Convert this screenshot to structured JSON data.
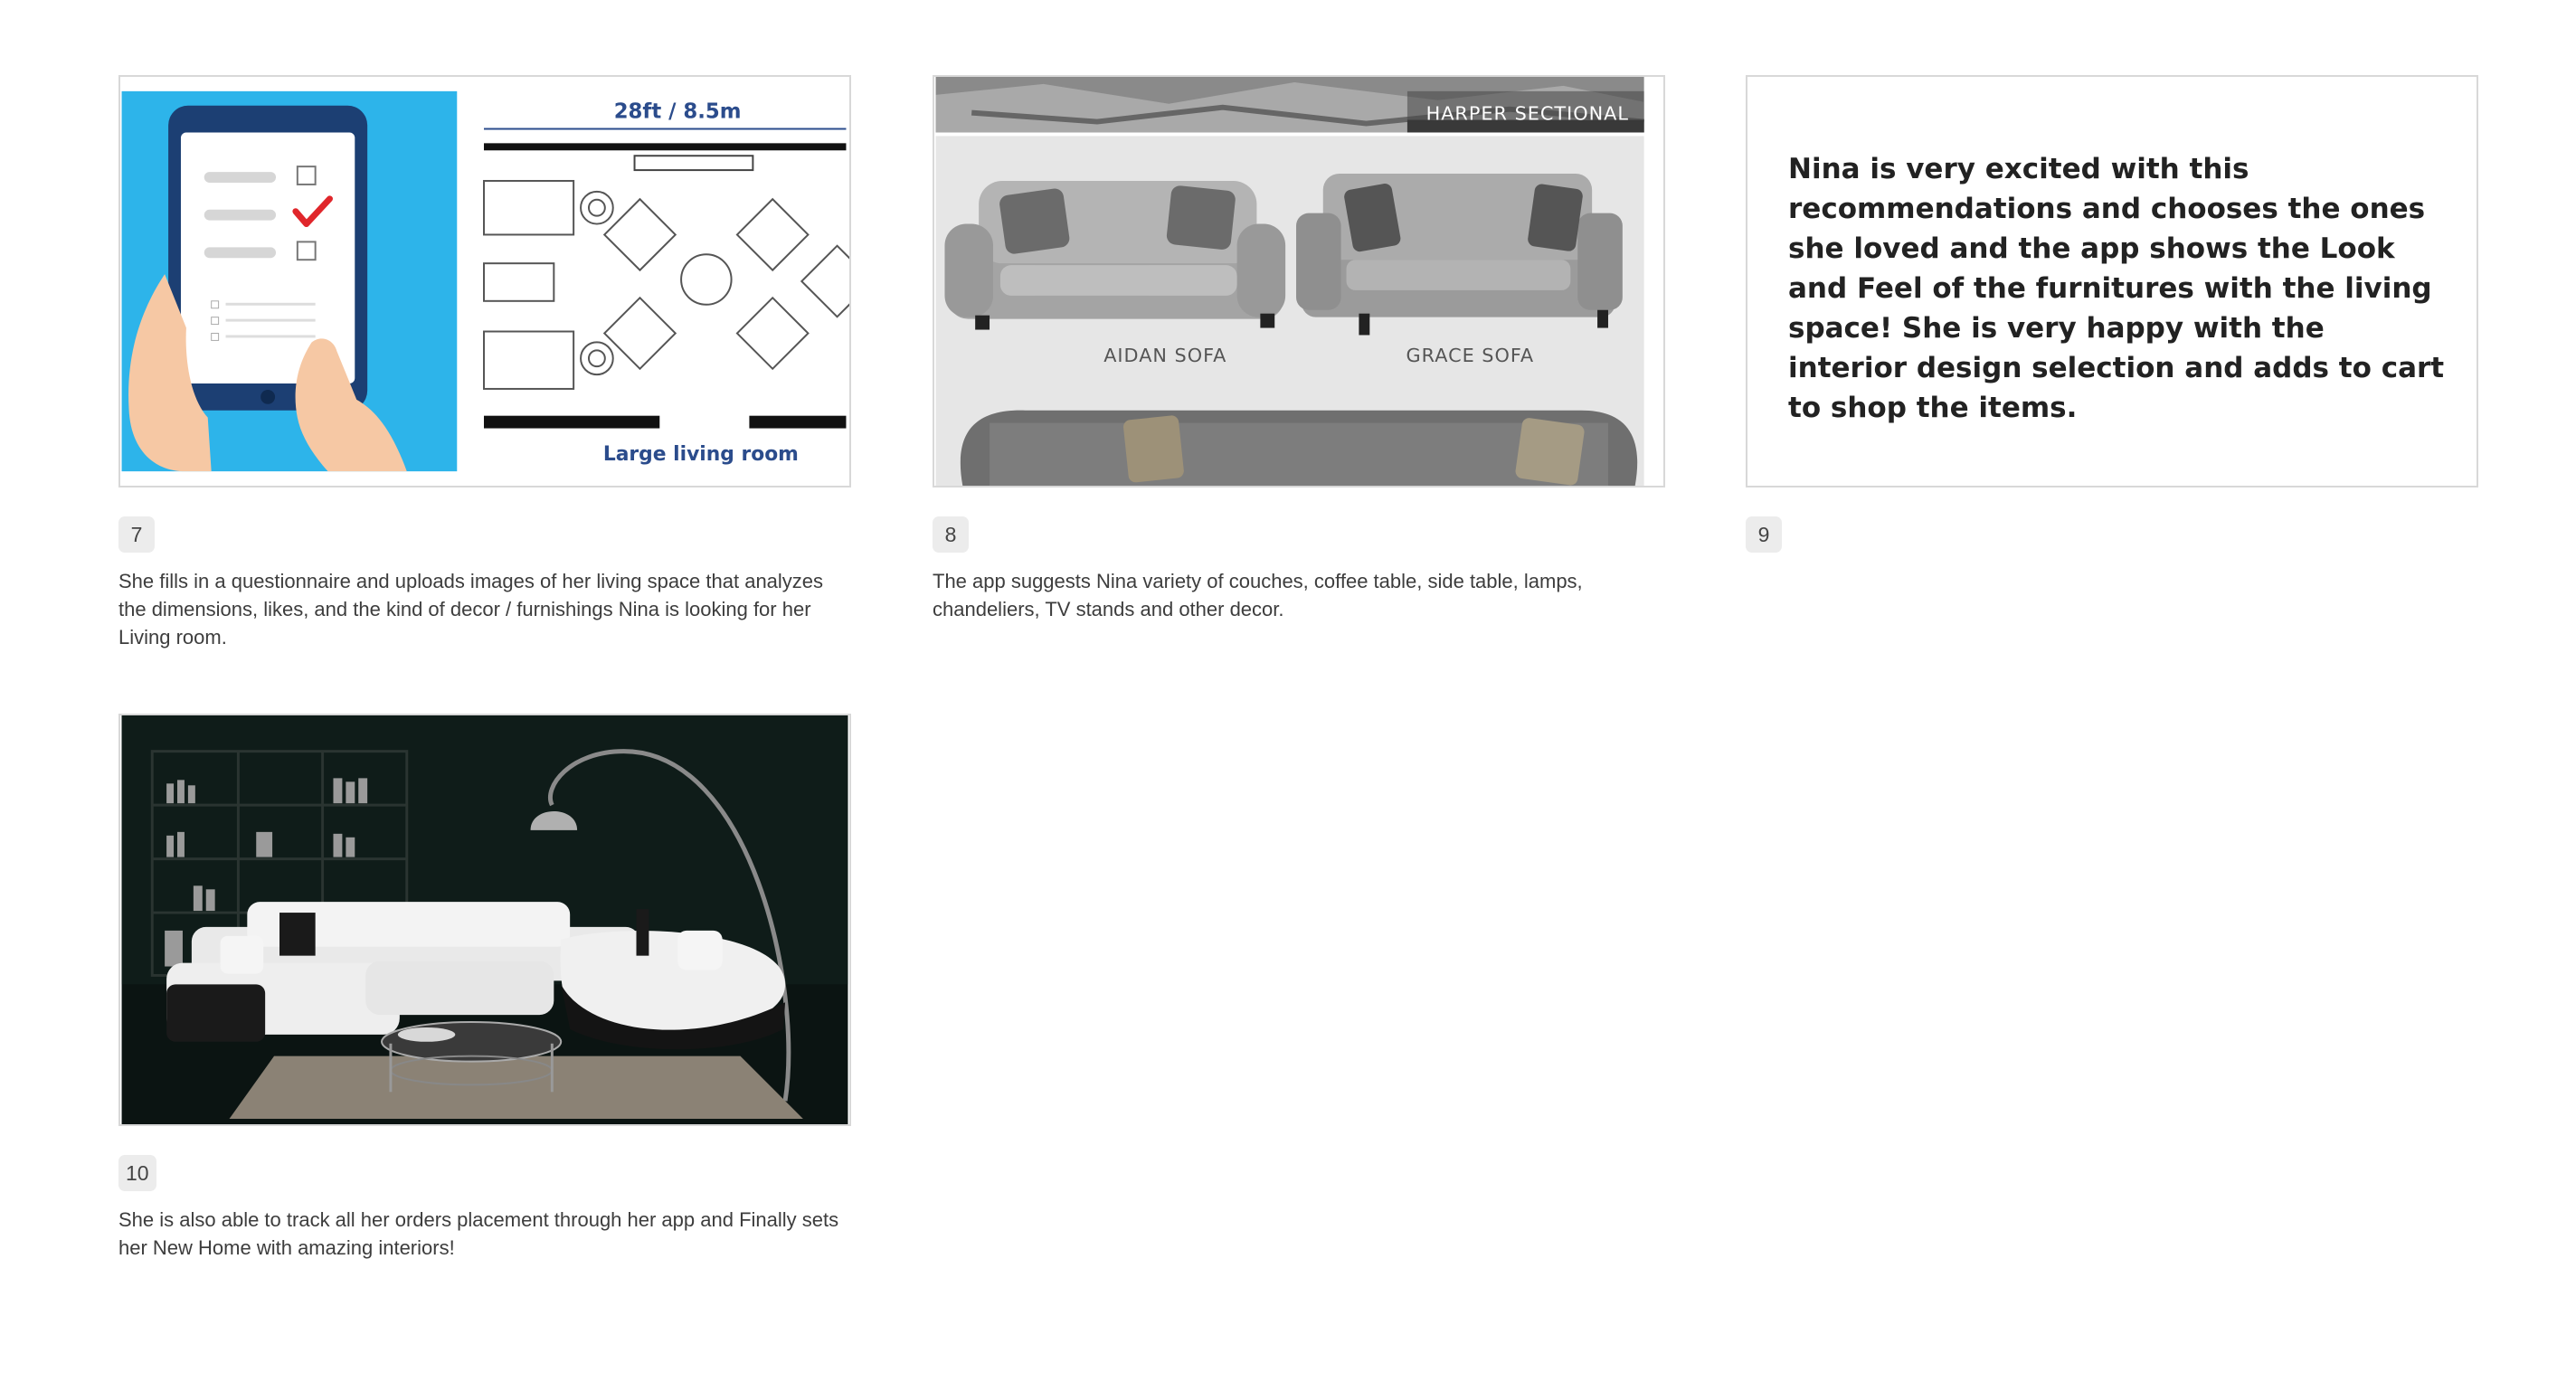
{
  "cards": [
    {
      "number": "7",
      "caption": "She fills in a questionnaire and uploads images of her living space that analyzes the dimensions, likes, and the kind of decor / furnishings Nina is looking for her Living room.",
      "image": {
        "floorplan_dimension": "28ft / 8.5m",
        "floorplan_label": "Large living room"
      }
    },
    {
      "number": "8",
      "caption": "The app suggests Nina variety of couches, coffee table, side table, lamps, chandeliers, TV stands and other decor.",
      "image": {
        "sofa_labels": [
          "HARPER SECTIONAL",
          "AIDAN SOFA",
          "GRACE SOFA"
        ]
      }
    },
    {
      "number": "9",
      "caption": "",
      "slide_text": "Nina is very excited with this recommendations and chooses the ones she loved and the app shows the Look and Feel of the furnitures with the living space!  She is very happy with the interior design selection and adds to cart to shop the items."
    },
    {
      "number": "10",
      "caption": "She is also able to track all her orders placement through her app and Finally sets her New Home with amazing interiors!"
    }
  ],
  "colors": {
    "tablet_bg": "#2db4ea",
    "plan_text": "#2b4c8c",
    "check": "#e0262b",
    "sofa_panel": "#e6e6e6",
    "dark_room": "#0b1412"
  }
}
